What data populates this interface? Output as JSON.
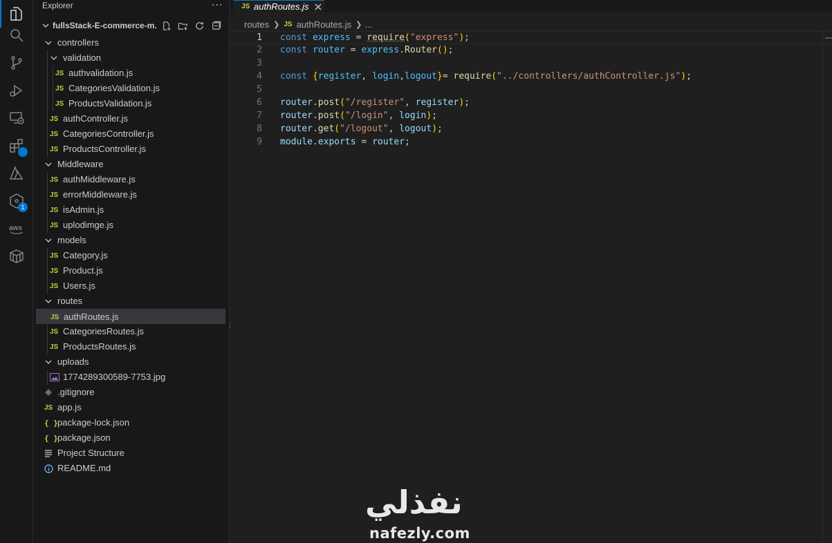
{
  "activity_bar": {
    "items": [
      {
        "icon": "explorer-icon",
        "active": true
      },
      {
        "icon": "search-icon"
      },
      {
        "icon": "source-control-icon"
      },
      {
        "icon": "run-debug-icon"
      },
      {
        "icon": "remote-explorer-icon"
      },
      {
        "icon": "extensions-icon"
      },
      {
        "icon": "azure-icon"
      },
      {
        "icon": "gitlens-icon",
        "badge": "1"
      },
      {
        "icon": "aws-icon"
      },
      {
        "icon": "containers-icon"
      }
    ]
  },
  "sidebar": {
    "title": "Explorer",
    "more": "···",
    "project": "fullsStack-E-commerce-m...",
    "tree": [
      {
        "label": "controllers",
        "type": "folder",
        "depth": 1
      },
      {
        "label": "validation",
        "type": "folder",
        "depth": 2
      },
      {
        "label": "authvalidation.js",
        "type": "js",
        "depth": 3
      },
      {
        "label": "CategoriesValidation.js",
        "type": "js",
        "depth": 3
      },
      {
        "label": "ProductsValidation.js",
        "type": "js",
        "depth": 3
      },
      {
        "label": "authController.js",
        "type": "js",
        "depth": 2
      },
      {
        "label": "CategoriesController.js",
        "type": "js",
        "depth": 2
      },
      {
        "label": "ProductsController.js",
        "type": "js",
        "depth": 2
      },
      {
        "label": "Middleware",
        "type": "folder",
        "depth": 1
      },
      {
        "label": "authMiddleware.js",
        "type": "js",
        "depth": 2
      },
      {
        "label": "errorMiddleware.js",
        "type": "js",
        "depth": 2
      },
      {
        "label": "isAdmin.js",
        "type": "js",
        "depth": 2
      },
      {
        "label": "uplodimge.js",
        "type": "js",
        "depth": 2
      },
      {
        "label": "models",
        "type": "folder",
        "depth": 1
      },
      {
        "label": "Category.js",
        "type": "js",
        "depth": 2
      },
      {
        "label": "Product.js",
        "type": "js",
        "depth": 2
      },
      {
        "label": "Users.js",
        "type": "js",
        "depth": 2
      },
      {
        "label": "routes",
        "type": "folder",
        "depth": 1
      },
      {
        "label": "authRoutes.js",
        "type": "js",
        "depth": 2,
        "selected": true
      },
      {
        "label": "CategoriesRoutes.js",
        "type": "js",
        "depth": 2
      },
      {
        "label": "ProductsRoutes.js",
        "type": "js",
        "depth": 2
      },
      {
        "label": "uploads",
        "type": "folder",
        "depth": 1
      },
      {
        "label": "1774289300589-7753.jpg",
        "type": "image",
        "depth": 2
      },
      {
        "label": ".gitignore",
        "type": "git",
        "depth": 1
      },
      {
        "label": "app.js",
        "type": "js",
        "depth": 1
      },
      {
        "label": "package-lock.json",
        "type": "json",
        "depth": 1
      },
      {
        "label": "package.json",
        "type": "json",
        "depth": 1
      },
      {
        "label": "Project Structure",
        "type": "text",
        "depth": 1
      },
      {
        "label": "README.md",
        "type": "info",
        "depth": 1
      }
    ]
  },
  "editor": {
    "tab": {
      "icon_text": "JS",
      "label": "authRoutes.js"
    },
    "breadcrumb": {
      "folder": "routes",
      "icon_text": "JS",
      "file": "authRoutes.js",
      "more": "..."
    },
    "lines": [
      {
        "n": "1"
      },
      {
        "n": "2"
      },
      {
        "n": "3"
      },
      {
        "n": "4"
      },
      {
        "n": "5"
      },
      {
        "n": "6"
      },
      {
        "n": "7"
      },
      {
        "n": "8"
      },
      {
        "n": "9"
      }
    ],
    "tokens": {
      "const": "const",
      "express": "express",
      "eq": " = ",
      "require": "require",
      "lp": "(",
      "rp": ")",
      "semi": ";",
      "str_express": "\"express\"",
      "router": "router",
      "dot": ".",
      "Router": "Router",
      "lbrace": "{",
      "rbrace": "}",
      "register": "register",
      "comma_sp": ", ",
      "comma": ",",
      "login": "login",
      "logout": "logout",
      "eq_tight": "= ",
      "str_controller": "\"../controllers/authController.js\"",
      "post": "post",
      "get": "get",
      "str_register": "\"/register\"",
      "str_login": "\"/login\"",
      "str_logout": "\"/logout\"",
      "module": "module",
      "exports": "exports",
      "sp": " "
    }
  },
  "watermark": {
    "arabic": "نفذلي",
    "latin": "nafezly.com"
  },
  "colors": {
    "accent": "#0078d4",
    "js_icon": "#cbcb41",
    "keyword": "#569cd6",
    "string": "#ce9178"
  }
}
